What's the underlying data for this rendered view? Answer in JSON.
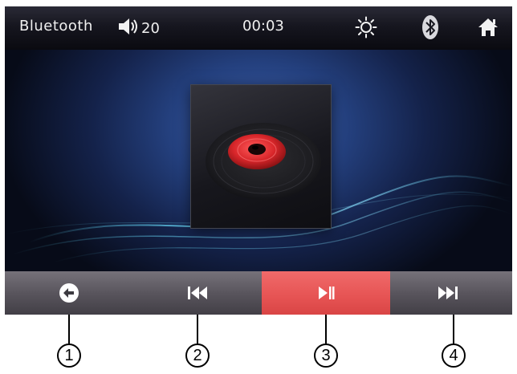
{
  "status_bar": {
    "source": "Bluetooth",
    "volume": "20",
    "time": "00:03",
    "icons": [
      "speaker-icon",
      "brightness-icon",
      "bluetooth-icon",
      "home-icon"
    ]
  },
  "now_playing": {
    "art_icon": "vinyl-disc-icon"
  },
  "controls": [
    {
      "id": "back",
      "icon": "back-arrow-icon",
      "active": false
    },
    {
      "id": "previous",
      "icon": "previous-track-icon",
      "active": false
    },
    {
      "id": "play_pause",
      "icon": "play-pause-icon",
      "active": true
    },
    {
      "id": "next",
      "icon": "next-track-icon",
      "active": false
    }
  ],
  "callouts": [
    "1",
    "2",
    "3",
    "4"
  ],
  "colors": {
    "status_bar": "#16161f",
    "background_blue": "#24407e",
    "control_bar": "#59555d",
    "active_button": "#e65353",
    "disc_red": "#d8262a"
  }
}
